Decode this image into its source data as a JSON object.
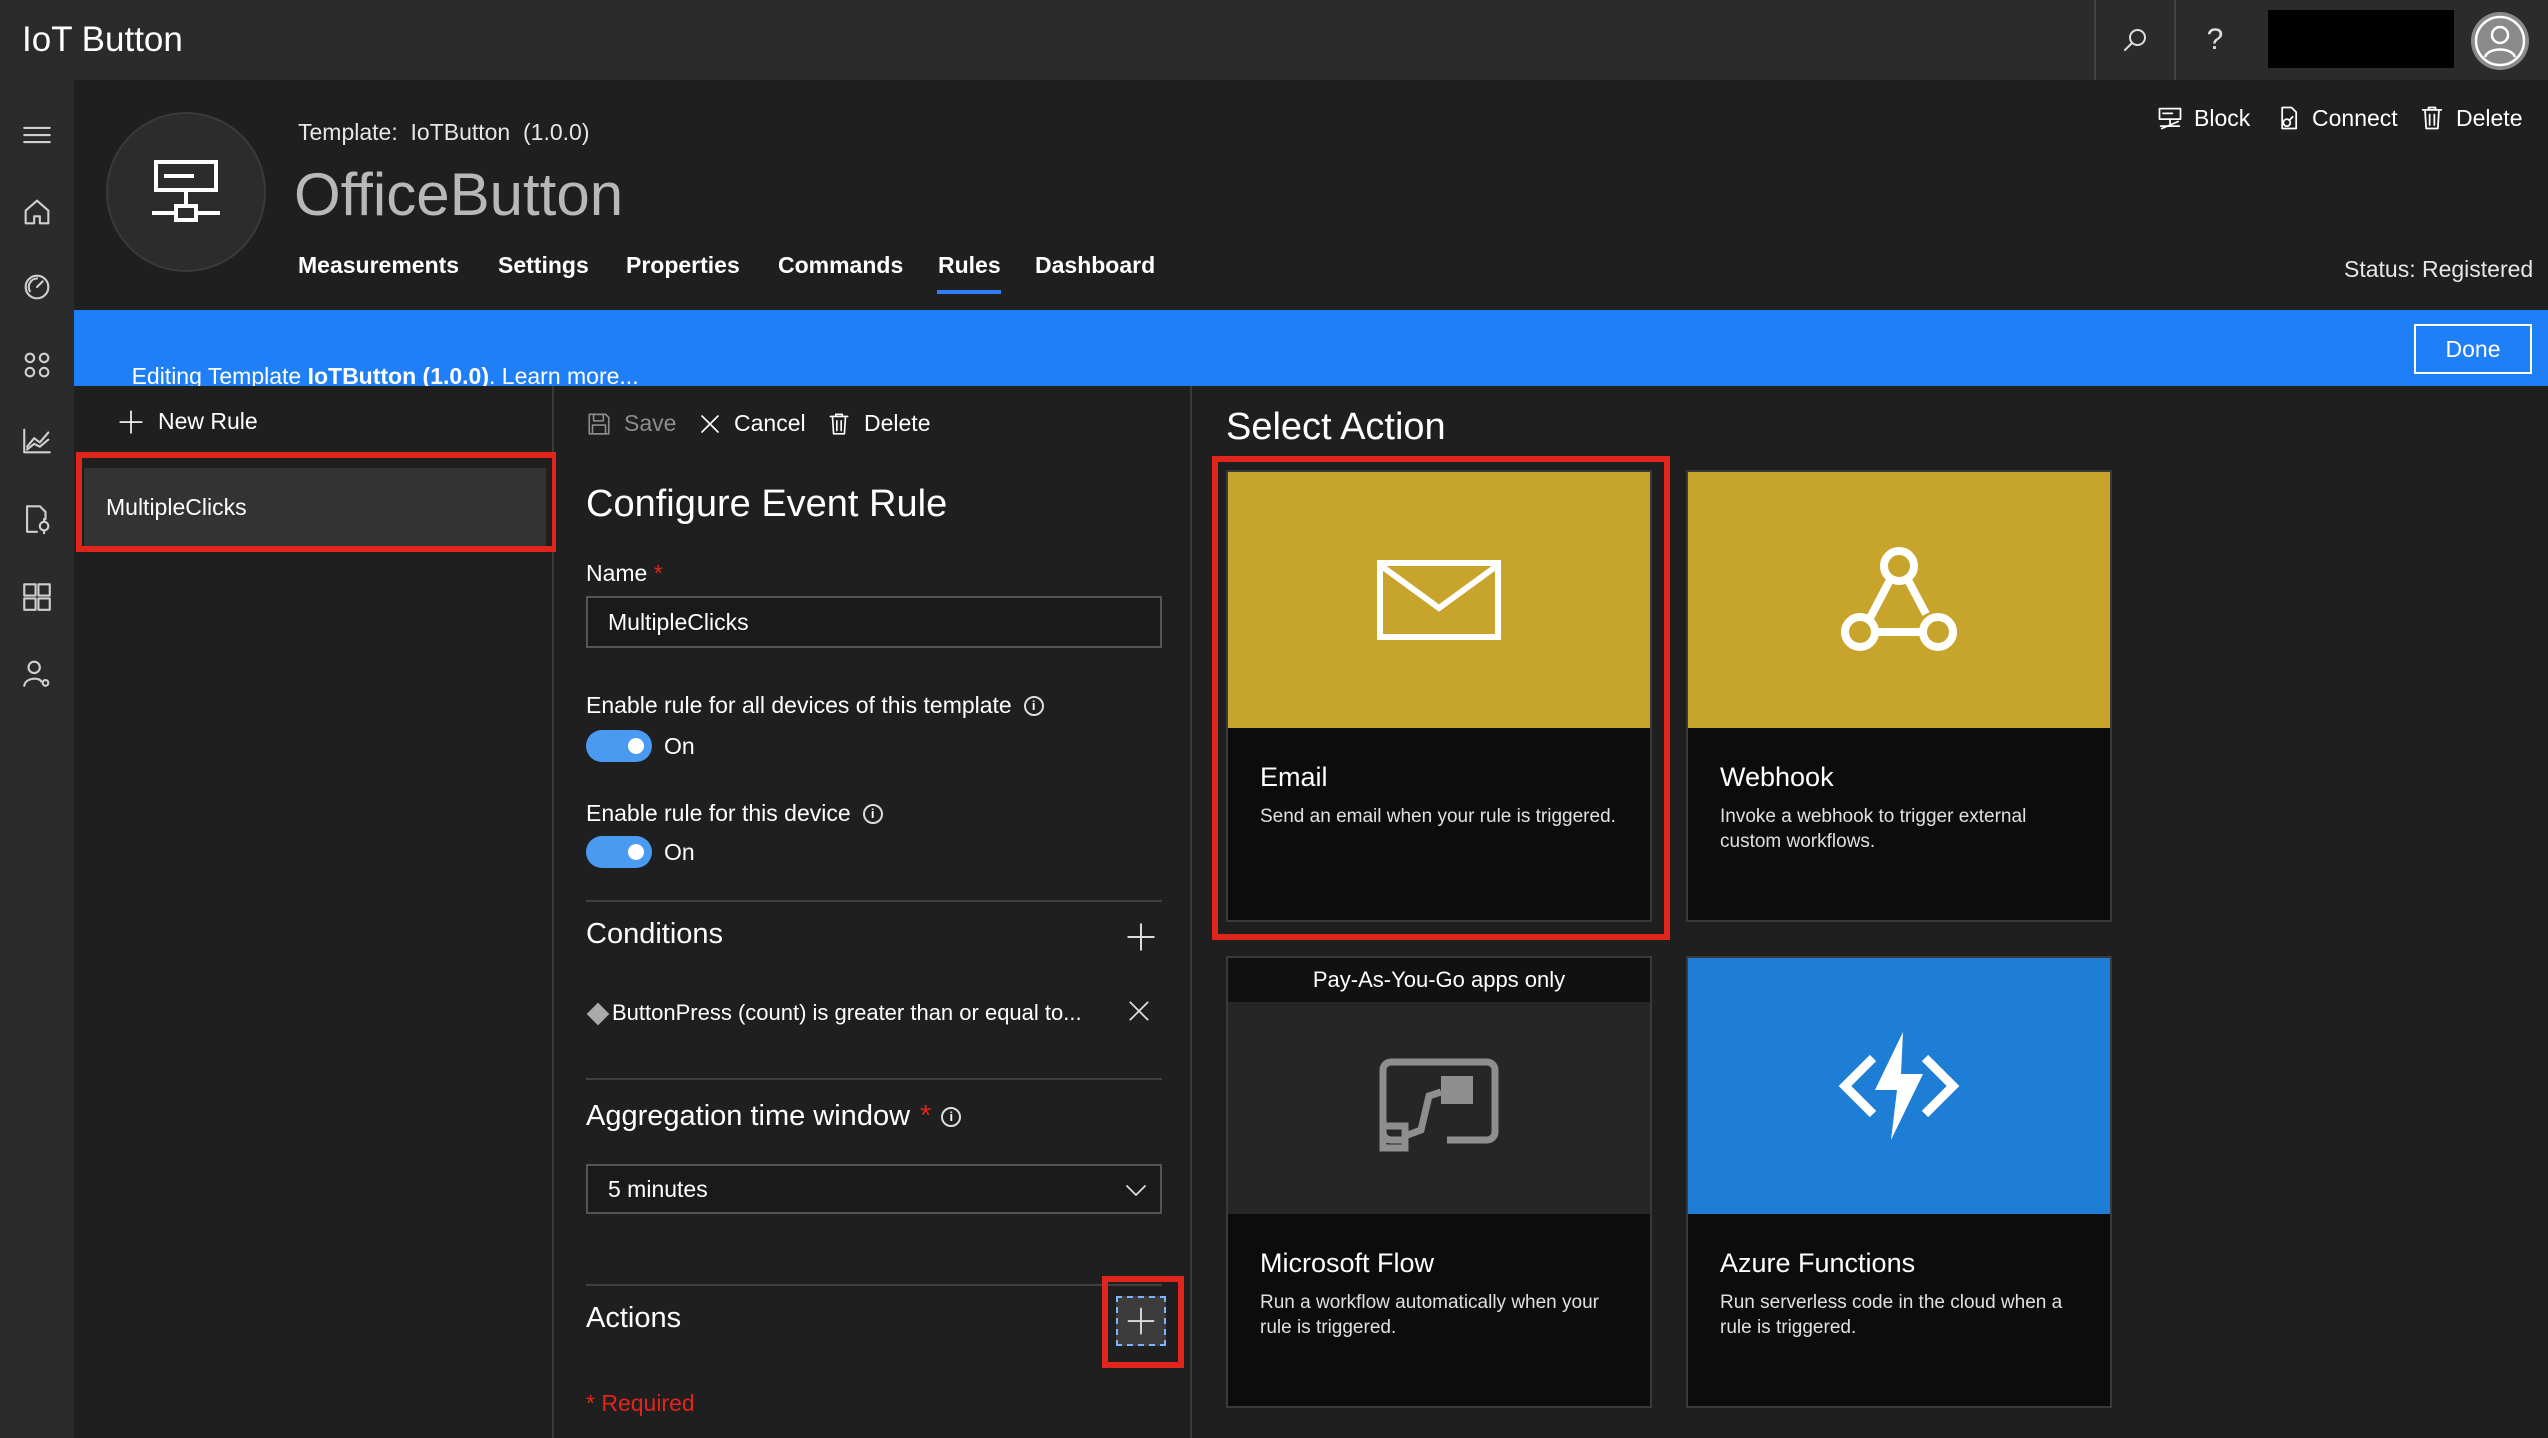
{
  "app": {
    "title": "IoT Button"
  },
  "topbar": {
    "search_icon": "search-icon",
    "help_label": "?",
    "avatar_icon": "user-icon"
  },
  "leftrail": {
    "items": [
      "menu-icon",
      "home-icon",
      "dashboard-icon",
      "apps-icon",
      "analytics-icon",
      "jobs-icon",
      "templates-icon",
      "admin-icon"
    ]
  },
  "header": {
    "template_line": "Template:  IoTButton  (1.0.0)",
    "device_name": "OfficeButton",
    "tabs": [
      "Measurements",
      "Settings",
      "Properties",
      "Commands",
      "Rules",
      "Dashboard"
    ],
    "active_tab": "Rules",
    "actions": {
      "block": "Block",
      "connect": "Connect",
      "delete": "Delete"
    },
    "status": "Status: Registered"
  },
  "banner": {
    "prefix": "Editing Template ",
    "template": "IoTButton (1.0.0)",
    "suffix": ". Learn more...",
    "done": "Done"
  },
  "rules": {
    "new_rule": "New Rule",
    "items": [
      "MultipleClicks"
    ]
  },
  "config": {
    "toolbar": {
      "save": "Save",
      "cancel": "Cancel",
      "delete": "Delete"
    },
    "title": "Configure Event Rule",
    "name_label": "Name",
    "required_mark": "*",
    "name_value": "MultipleClicks",
    "enable_all_label": "Enable rule for all devices of this template",
    "enable_all_state": "On",
    "enable_device_label": "Enable rule for this device",
    "enable_device_state": "On",
    "conditions_title": "Conditions",
    "condition_text": "ButtonPress (count) is greater than or equal to...",
    "aggregation_title": "Aggregation time window",
    "aggregation_value": "5 minutes",
    "actions_title": "Actions",
    "required_note": "* Required"
  },
  "select_action": {
    "title": "Select Action",
    "cards": [
      {
        "title": "Email",
        "desc": "Send an email when your rule is triggered.",
        "color": "#c7a42c",
        "icon": "mail-icon"
      },
      {
        "title": "Webhook",
        "desc": "Invoke a webhook to trigger external custom workflows.",
        "color": "#c7a42c",
        "icon": "webhook-icon"
      },
      {
        "title": "Microsoft Flow",
        "desc": "Run a workflow automatically when your rule is triggered.",
        "color": "#262626",
        "icon": "flow-icon",
        "band": "Pay-As-You-Go apps only"
      },
      {
        "title": "Azure Functions",
        "desc": "Run serverless code in the cloud when a rule is triggered.",
        "color": "#1e7ed6",
        "icon": "functions-icon"
      }
    ]
  },
  "colors": {
    "accent": "#1e7ff7",
    "highlight": "#e0251c",
    "toggle": "#4a9af2",
    "gold": "#c7a42c",
    "azure": "#1e7ed6"
  }
}
